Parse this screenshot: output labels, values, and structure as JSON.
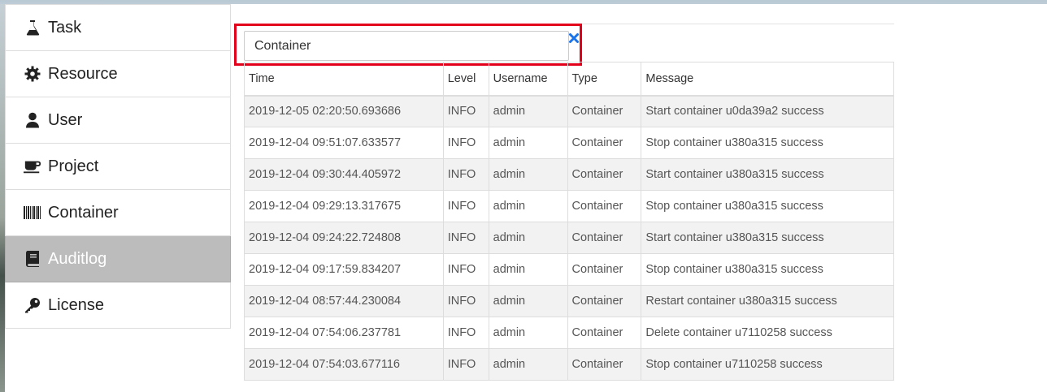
{
  "sidebar": {
    "items": [
      {
        "label": "Task",
        "icon": "flask-icon",
        "active": false
      },
      {
        "label": "Resource",
        "icon": "gear-icon",
        "active": false
      },
      {
        "label": "User",
        "icon": "user-icon",
        "active": false
      },
      {
        "label": "Project",
        "icon": "coffee-cup-icon",
        "active": false
      },
      {
        "label": "Container",
        "icon": "barcode-icon",
        "active": false
      },
      {
        "label": "Auditlog",
        "icon": "book-icon",
        "active": true
      },
      {
        "label": "License",
        "icon": "key-icon",
        "active": false
      }
    ]
  },
  "search": {
    "value": "Container"
  },
  "table": {
    "headers": [
      "Time",
      "Level",
      "Username",
      "Type",
      "Message"
    ],
    "rows": [
      [
        "2019-12-05 02:20:50.693686",
        "INFO",
        "admin",
        "Container",
        "Start container u0da39a2 success"
      ],
      [
        "2019-12-04 09:51:07.633577",
        "INFO",
        "admin",
        "Container",
        "Stop container u380a315 success"
      ],
      [
        "2019-12-04 09:30:44.405972",
        "INFO",
        "admin",
        "Container",
        "Start container u380a315 success"
      ],
      [
        "2019-12-04 09:29:13.317675",
        "INFO",
        "admin",
        "Container",
        "Stop container u380a315 success"
      ],
      [
        "2019-12-04 09:24:22.724808",
        "INFO",
        "admin",
        "Container",
        "Start container u380a315 success"
      ],
      [
        "2019-12-04 09:17:59.834207",
        "INFO",
        "admin",
        "Container",
        "Stop container u380a315 success"
      ],
      [
        "2019-12-04 08:57:44.230084",
        "INFO",
        "admin",
        "Container",
        "Restart container u380a315 success"
      ],
      [
        "2019-12-04 07:54:06.237781",
        "INFO",
        "admin",
        "Container",
        "Delete container u7110258 success"
      ],
      [
        "2019-12-04 07:54:03.677116",
        "INFO",
        "admin",
        "Container",
        "Stop container u7110258 success"
      ]
    ]
  },
  "colors": {
    "highlight": "#e3001b",
    "active_bg": "#bcbcbc",
    "clear_icon": "#1a73e8"
  }
}
